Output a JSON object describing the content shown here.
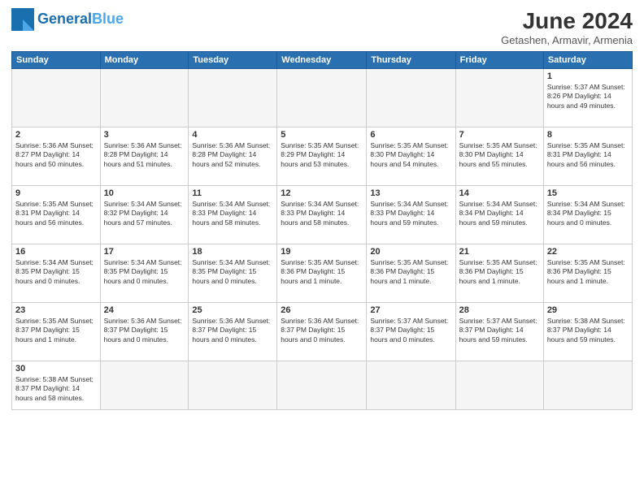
{
  "header": {
    "logo_general": "General",
    "logo_blue": "Blue",
    "title": "June 2024",
    "location": "Getashen, Armavir, Armenia"
  },
  "days_of_week": [
    "Sunday",
    "Monday",
    "Tuesday",
    "Wednesday",
    "Thursday",
    "Friday",
    "Saturday"
  ],
  "weeks": [
    [
      {
        "day": "",
        "info": ""
      },
      {
        "day": "",
        "info": ""
      },
      {
        "day": "",
        "info": ""
      },
      {
        "day": "",
        "info": ""
      },
      {
        "day": "",
        "info": ""
      },
      {
        "day": "",
        "info": ""
      },
      {
        "day": "1",
        "info": "Sunrise: 5:37 AM\nSunset: 8:26 PM\nDaylight: 14 hours\nand 49 minutes."
      }
    ],
    [
      {
        "day": "2",
        "info": "Sunrise: 5:36 AM\nSunset: 8:27 PM\nDaylight: 14 hours\nand 50 minutes."
      },
      {
        "day": "3",
        "info": "Sunrise: 5:36 AM\nSunset: 8:28 PM\nDaylight: 14 hours\nand 51 minutes."
      },
      {
        "day": "4",
        "info": "Sunrise: 5:36 AM\nSunset: 8:28 PM\nDaylight: 14 hours\nand 52 minutes."
      },
      {
        "day": "5",
        "info": "Sunrise: 5:35 AM\nSunset: 8:29 PM\nDaylight: 14 hours\nand 53 minutes."
      },
      {
        "day": "6",
        "info": "Sunrise: 5:35 AM\nSunset: 8:30 PM\nDaylight: 14 hours\nand 54 minutes."
      },
      {
        "day": "7",
        "info": "Sunrise: 5:35 AM\nSunset: 8:30 PM\nDaylight: 14 hours\nand 55 minutes."
      },
      {
        "day": "8",
        "info": "Sunrise: 5:35 AM\nSunset: 8:31 PM\nDaylight: 14 hours\nand 56 minutes."
      }
    ],
    [
      {
        "day": "9",
        "info": "Sunrise: 5:35 AM\nSunset: 8:31 PM\nDaylight: 14 hours\nand 56 minutes."
      },
      {
        "day": "10",
        "info": "Sunrise: 5:34 AM\nSunset: 8:32 PM\nDaylight: 14 hours\nand 57 minutes."
      },
      {
        "day": "11",
        "info": "Sunrise: 5:34 AM\nSunset: 8:33 PM\nDaylight: 14 hours\nand 58 minutes."
      },
      {
        "day": "12",
        "info": "Sunrise: 5:34 AM\nSunset: 8:33 PM\nDaylight: 14 hours\nand 58 minutes."
      },
      {
        "day": "13",
        "info": "Sunrise: 5:34 AM\nSunset: 8:33 PM\nDaylight: 14 hours\nand 59 minutes."
      },
      {
        "day": "14",
        "info": "Sunrise: 5:34 AM\nSunset: 8:34 PM\nDaylight: 14 hours\nand 59 minutes."
      },
      {
        "day": "15",
        "info": "Sunrise: 5:34 AM\nSunset: 8:34 PM\nDaylight: 15 hours\nand 0 minutes."
      }
    ],
    [
      {
        "day": "16",
        "info": "Sunrise: 5:34 AM\nSunset: 8:35 PM\nDaylight: 15 hours\nand 0 minutes."
      },
      {
        "day": "17",
        "info": "Sunrise: 5:34 AM\nSunset: 8:35 PM\nDaylight: 15 hours\nand 0 minutes."
      },
      {
        "day": "18",
        "info": "Sunrise: 5:34 AM\nSunset: 8:35 PM\nDaylight: 15 hours\nand 0 minutes."
      },
      {
        "day": "19",
        "info": "Sunrise: 5:35 AM\nSunset: 8:36 PM\nDaylight: 15 hours\nand 1 minute."
      },
      {
        "day": "20",
        "info": "Sunrise: 5:35 AM\nSunset: 8:36 PM\nDaylight: 15 hours\nand 1 minute."
      },
      {
        "day": "21",
        "info": "Sunrise: 5:35 AM\nSunset: 8:36 PM\nDaylight: 15 hours\nand 1 minute."
      },
      {
        "day": "22",
        "info": "Sunrise: 5:35 AM\nSunset: 8:36 PM\nDaylight: 15 hours\nand 1 minute."
      }
    ],
    [
      {
        "day": "23",
        "info": "Sunrise: 5:35 AM\nSunset: 8:37 PM\nDaylight: 15 hours\nand 1 minute."
      },
      {
        "day": "24",
        "info": "Sunrise: 5:36 AM\nSunset: 8:37 PM\nDaylight: 15 hours\nand 0 minutes."
      },
      {
        "day": "25",
        "info": "Sunrise: 5:36 AM\nSunset: 8:37 PM\nDaylight: 15 hours\nand 0 minutes."
      },
      {
        "day": "26",
        "info": "Sunrise: 5:36 AM\nSunset: 8:37 PM\nDaylight: 15 hours\nand 0 minutes."
      },
      {
        "day": "27",
        "info": "Sunrise: 5:37 AM\nSunset: 8:37 PM\nDaylight: 15 hours\nand 0 minutes."
      },
      {
        "day": "28",
        "info": "Sunrise: 5:37 AM\nSunset: 8:37 PM\nDaylight: 14 hours\nand 59 minutes."
      },
      {
        "day": "29",
        "info": "Sunrise: 5:38 AM\nSunset: 8:37 PM\nDaylight: 14 hours\nand 59 minutes."
      }
    ],
    [
      {
        "day": "30",
        "info": "Sunrise: 5:38 AM\nSunset: 8:37 PM\nDaylight: 14 hours\nand 58 minutes."
      },
      {
        "day": "",
        "info": ""
      },
      {
        "day": "",
        "info": ""
      },
      {
        "day": "",
        "info": ""
      },
      {
        "day": "",
        "info": ""
      },
      {
        "day": "",
        "info": ""
      },
      {
        "day": "",
        "info": ""
      }
    ]
  ]
}
